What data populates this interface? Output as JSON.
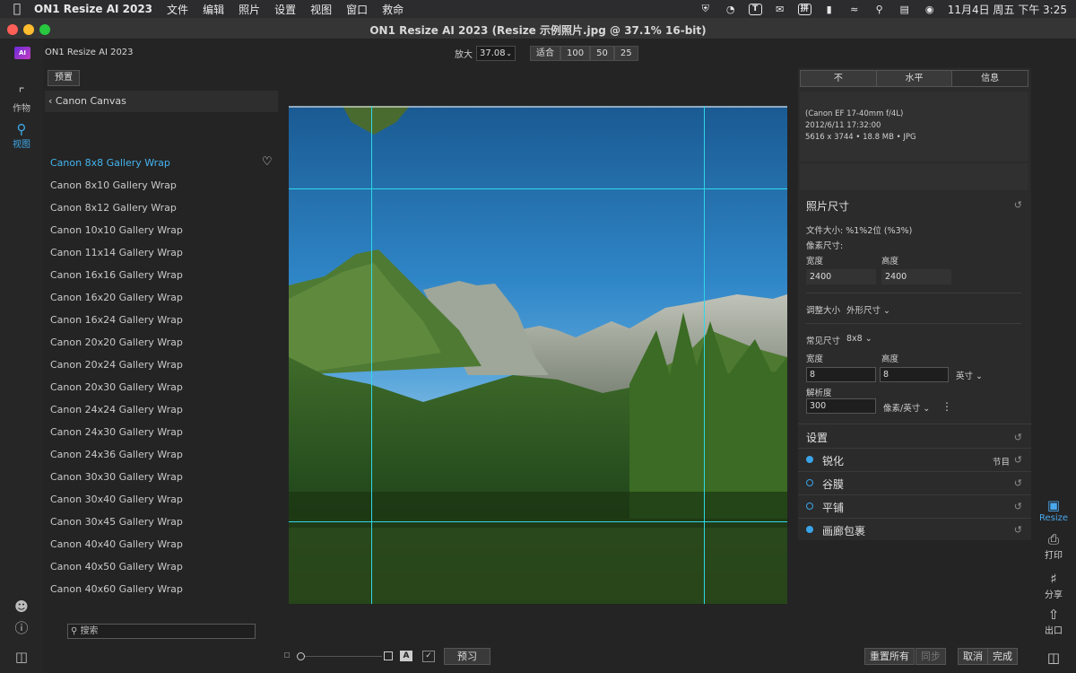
{
  "menubar": {
    "app_name": "ON1 Resize AI 2023",
    "menus": [
      "文件",
      "编辑",
      "照片",
      "设置",
      "视图",
      "窗口",
      "救命"
    ],
    "status": {
      "t_icon": "T",
      "grid_icon": "拼",
      "clock": "11月4日 周五 下午 3:25"
    }
  },
  "window": {
    "title": "ON1 Resize AI 2023 (Resize 示例照片.jpg @ 37.1% 16-bit)"
  },
  "toolbar": {
    "app_label": "ON1 Resize AI 2023",
    "zoom_label": "放大",
    "zoom_value": "37.08",
    "fit_label": "适合",
    "zoom_100": "100",
    "zoom_50": "50",
    "zoom_25": "25"
  },
  "rail": {
    "crop_label": "作物",
    "view_label": "视图"
  },
  "presets": {
    "tag": "预置",
    "category": "Canon Canvas",
    "items": [
      "Canon 8x8 Gallery Wrap",
      "Canon 8x10 Gallery Wrap",
      "Canon 8x12 Gallery Wrap",
      "Canon 10x10 Gallery Wrap",
      "Canon 11x14 Gallery Wrap",
      "Canon 16x16 Gallery Wrap",
      "Canon 16x20 Gallery Wrap",
      "Canon 16x24 Gallery Wrap",
      "Canon 20x20 Gallery Wrap",
      "Canon 20x24 Gallery Wrap",
      "Canon 20x30 Gallery Wrap",
      "Canon 24x24 Gallery Wrap",
      "Canon 24x30 Gallery Wrap",
      "Canon 24x36 Gallery Wrap",
      "Canon 30x30 Gallery Wrap",
      "Canon 30x40 Gallery Wrap",
      "Canon 30x45 Gallery Wrap",
      "Canon 40x40 Gallery Wrap",
      "Canon 40x50 Gallery Wrap",
      "Canon 40x60 Gallery Wrap"
    ],
    "search_placeholder": "搜索"
  },
  "info_panel": {
    "tabs": [
      "不",
      "水平",
      "信息"
    ],
    "lens": "(Canon EF 17-40mm f/4L)",
    "datetime": "2012/6/11  17:32:00",
    "details": "5616 x 3744 • 18.8 MB • JPG"
  },
  "photo_size": {
    "title": "照片尺寸",
    "file_size": "文件大小: %1%2位 (%3%)",
    "pixel_size_label": "像素尺寸:",
    "width_label": "宽度",
    "height_label": "高度",
    "pixel_width": "2400",
    "pixel_height": "2400",
    "resize_label": "调整大小",
    "resize_mode": "外形尺寸",
    "common_size_label": "常见尺寸",
    "common_size": "8x8",
    "doc_width_label": "宽度",
    "doc_height_label": "高度",
    "doc_width": "8",
    "doc_height": "8",
    "unit": "英寸",
    "resolution_label": "解析度",
    "resolution": "300",
    "resolution_unit": "像素/英寸"
  },
  "settings": {
    "title": "设置",
    "sections": [
      {
        "label": "锐化",
        "extra": "节目",
        "active": true
      },
      {
        "label": "谷膜",
        "extra": "",
        "active": false
      },
      {
        "label": "平铺",
        "extra": "",
        "active": false
      },
      {
        "label": "画廊包裹",
        "extra": "",
        "active": true
      }
    ]
  },
  "right_rail": {
    "resize_label": "Resize",
    "print_label": "打印",
    "share_label": "分享",
    "export_label": "出口"
  },
  "bottom": {
    "preview": "预习",
    "reset_all": "重置所有",
    "sync": "同步",
    "cancel": "取消",
    "done": "完成"
  },
  "colors": {
    "accent": "#44b4f0",
    "guide": "#2fd7e8"
  }
}
